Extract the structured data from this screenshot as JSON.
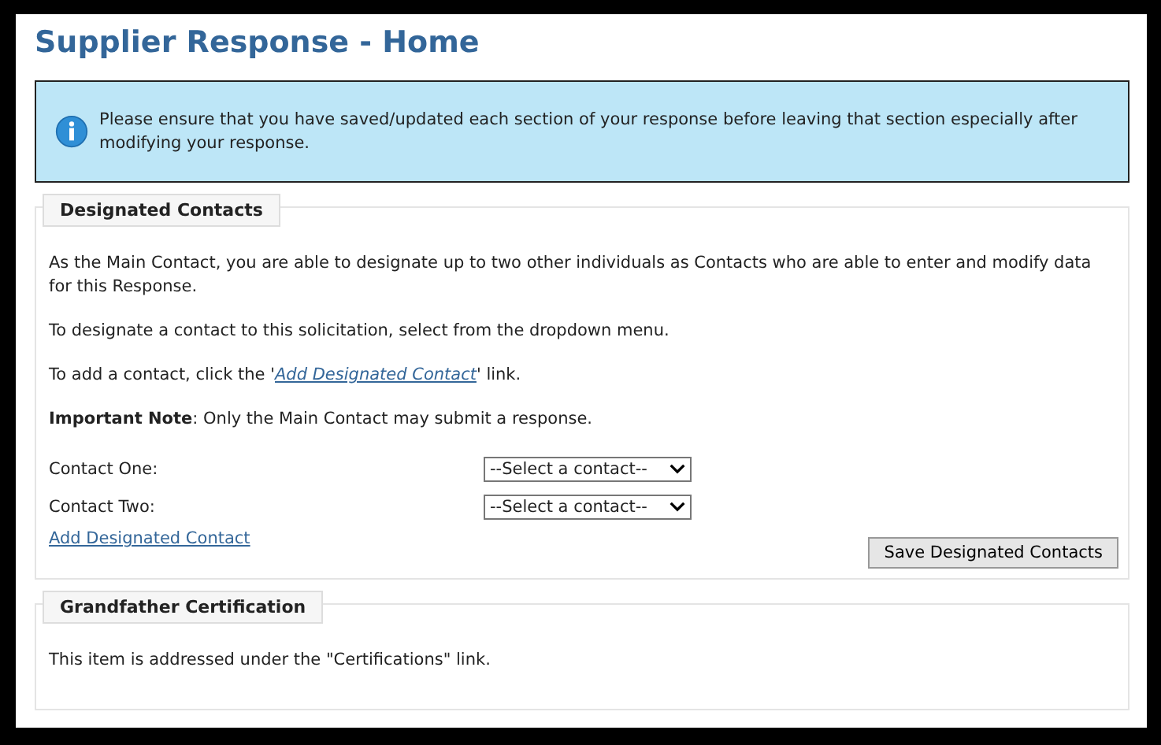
{
  "title": "Supplier Response - Home",
  "notice": "Please ensure that you have saved/updated each section of your response before leaving that section especially after modifying your response.",
  "designated": {
    "legend": "Designated Contacts",
    "intro": "As the Main Contact, you are able to designate up to two other individuals as Contacts who are able to enter and modify data for this Response.",
    "instruction": "To designate a contact to this solicitation, select from the dropdown menu.",
    "add_prefix": "To add a contact, click the '",
    "add_link": "Add Designated Contact",
    "add_suffix": "' link.",
    "note": "**Important Note**: Only the Main Contact may submit a response.",
    "contacts": [
      {
        "label": "Contact One:",
        "value": "--Select a contact--"
      },
      {
        "label": "Contact Two:",
        "value": "--Select a contact--"
      }
    ],
    "link": "Add Designated Contact",
    "button": "Save Designated Contacts"
  },
  "grandfather": {
    "legend": "Grandfather Certification",
    "text": "This item is addressed under the \"Certifications\" link."
  }
}
